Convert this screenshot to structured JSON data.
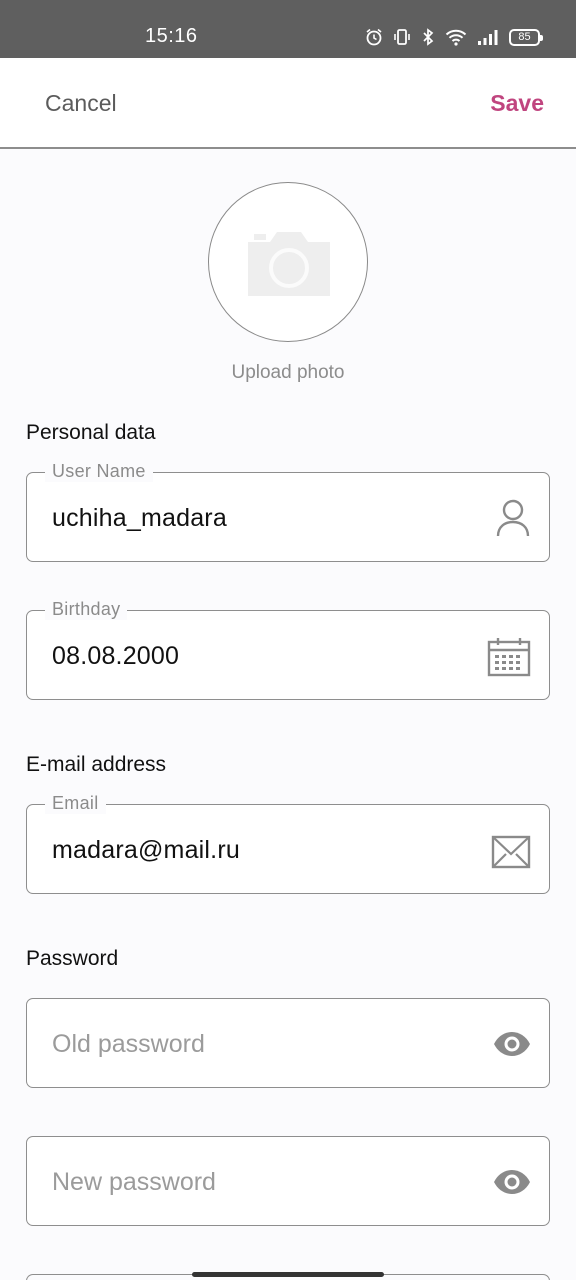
{
  "status_bar": {
    "time": "15:16",
    "battery": "85",
    "icons": [
      "alarm-icon",
      "vibrate-icon",
      "bluetooth-icon",
      "wifi-icon",
      "signal-icon",
      "battery-icon"
    ]
  },
  "header": {
    "cancel_label": "Cancel",
    "save_label": "Save",
    "save_color": "#c0457f"
  },
  "photo": {
    "upload_label": "Upload photo",
    "icon": "camera-icon"
  },
  "sections": {
    "personal": "Personal data",
    "email": "E-mail address",
    "password": "Password"
  },
  "fields": {
    "username": {
      "label": "User Name",
      "value": "uchiha_madara",
      "icon": "user-icon"
    },
    "birthday": {
      "label": "Birthday",
      "value": "08.08.2000",
      "icon": "calendar-icon"
    },
    "email": {
      "label": "Email",
      "value": "madara@mail.ru",
      "icon": "envelope-icon"
    },
    "old_password": {
      "placeholder": "Old password",
      "icon": "eye-icon"
    },
    "new_password": {
      "placeholder": "New password",
      "icon": "eye-icon"
    }
  }
}
